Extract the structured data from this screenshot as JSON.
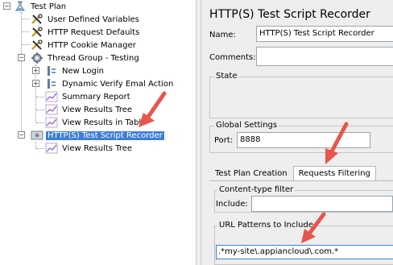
{
  "tree": {
    "items": [
      {
        "label": "Test Plan",
        "icon": "test-plan-icon"
      },
      {
        "label": "User Defined Variables",
        "icon": "tools-icon"
      },
      {
        "label": "HTTP Request Defaults",
        "icon": "tools-icon"
      },
      {
        "label": "HTTP Cookie Manager",
        "icon": "tools-icon"
      },
      {
        "label": "Thread Group - Testing",
        "icon": "gear-icon"
      },
      {
        "label": "New Login",
        "icon": "controller-icon"
      },
      {
        "label": "Dynamic Verify Emal Action",
        "icon": "controller-icon"
      },
      {
        "label": "Summary Report",
        "icon": "graph-icon"
      },
      {
        "label": "View Results Tree",
        "icon": "graph-icon"
      },
      {
        "label": "View Results in Table",
        "icon": "graph-icon"
      },
      {
        "label": "HTTP(S) Test Script Recorder",
        "icon": "recorder-icon"
      },
      {
        "label": "View Results Tree",
        "icon": "graph-icon"
      }
    ],
    "selected_index": 10,
    "expander_open": "−",
    "expander_closed": "+"
  },
  "panel": {
    "title": "HTTP(S) Test Script Recorder",
    "name_label": "Name:",
    "name_value": "HTTP(S) Test Script Recorder",
    "comments_label": "Comments:",
    "comments_value": "",
    "state_label": "State",
    "global_settings_label": "Global Settings",
    "port_label": "Port:",
    "port_value": "8888",
    "tabs": [
      {
        "label": "Test Plan Creation"
      },
      {
        "label": "Requests Filtering"
      }
    ],
    "active_tab": 1,
    "content_type_filter_label": "Content-type filter",
    "include_label": "Include:",
    "include_value": "",
    "url_patterns_label": "URL Patterns to Include",
    "url_pattern_value": ".*my-site\\.appiancloud\\.com.*"
  },
  "colors": {
    "arrow": "#e8554a",
    "selection": "#3d7fd6"
  }
}
